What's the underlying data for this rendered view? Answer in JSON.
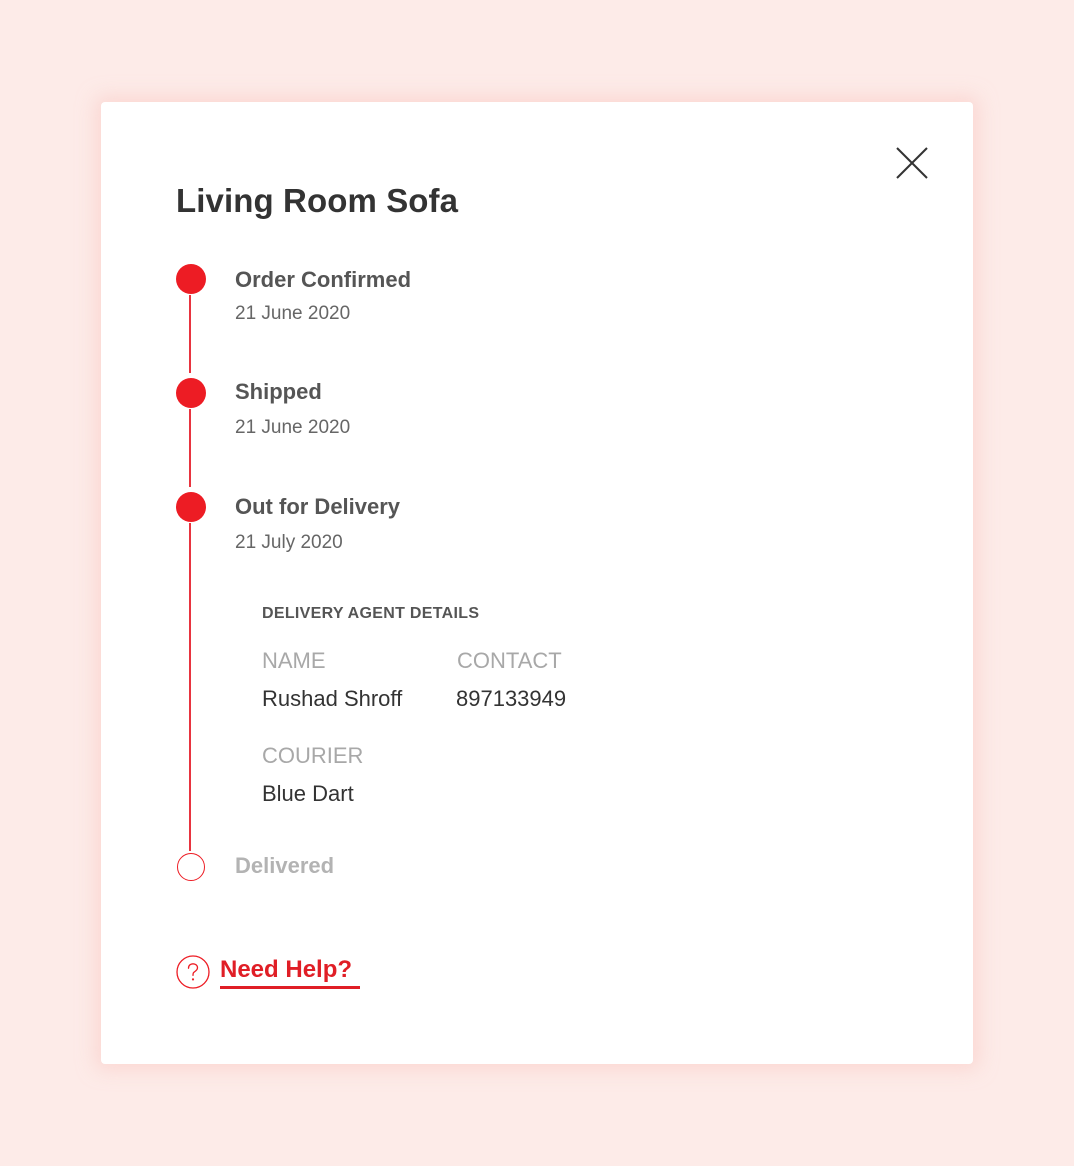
{
  "order": {
    "title": "Living Room Sofa"
  },
  "timeline": [
    {
      "label": "Order Confirmed",
      "date": "21 June 2020",
      "status": "done"
    },
    {
      "label": "Shipped",
      "date": "21 June 2020",
      "status": "done"
    },
    {
      "label": "Out for Delivery",
      "date": "21 July 2020",
      "status": "done"
    },
    {
      "label": "Delivered",
      "status": "pending"
    }
  ],
  "agent": {
    "heading": "DELIVERY AGENT DETAILS",
    "name_label": "NAME",
    "name_value": "Rushad Shroff",
    "contact_label": "CONTACT",
    "contact_value": "897133949",
    "courier_label": "COURIER",
    "courier_value": "Blue Dart"
  },
  "help": {
    "label": "Need Help?",
    "icon": "question-circle-icon"
  },
  "close": {
    "icon": "close-icon"
  },
  "colors": {
    "background": "#fdebe8",
    "card": "#ffffff",
    "accent": "#ed1c24",
    "text_primary": "#333333",
    "text_muted": "#a8a8a8"
  }
}
